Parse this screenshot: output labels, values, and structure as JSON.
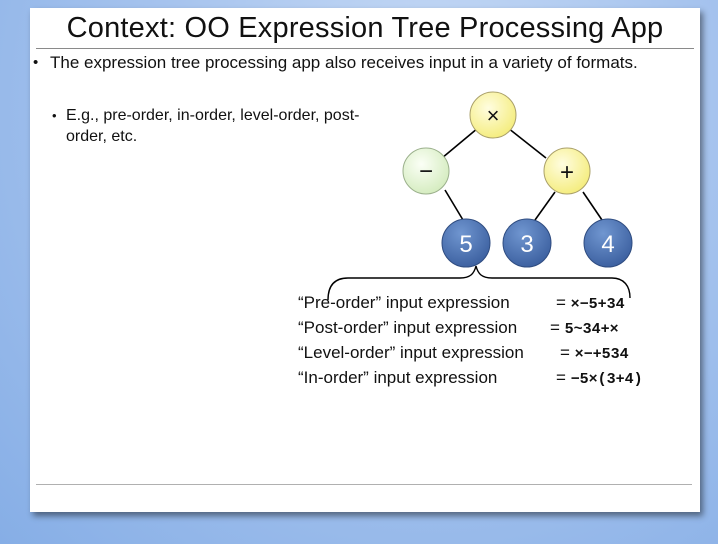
{
  "title": "Context: OO Expression Tree Processing App",
  "bullet1": "The expression tree processing app also receives input in a variety of formats.",
  "bullet1_marker": "•",
  "bullet2": "E.g., pre-order, in-order, level-order, post-order, etc.",
  "bullet2_marker": "•",
  "tree": {
    "root": "×",
    "minus": "−",
    "plus": "+",
    "leaf5": "5",
    "leaf3": "3",
    "leaf4": "4",
    "colors": {
      "operator_fill": "#fbf7a8",
      "minus_fill": "#e6f3d8",
      "leaf_fill": "#4a70ad"
    }
  },
  "expressions": [
    {
      "label": "“Pre-order” input expression",
      "eq": "=",
      "value": "×−5+34"
    },
    {
      "label": "“Post-order” input expression",
      "eq": "=",
      "value": "5~34+×"
    },
    {
      "label": "“Level-order” input expression",
      "eq": "=",
      "value": "×−+534"
    },
    {
      "label": "“In-order” input expression",
      "eq": "=",
      "value": "−5×(3+4)"
    }
  ]
}
